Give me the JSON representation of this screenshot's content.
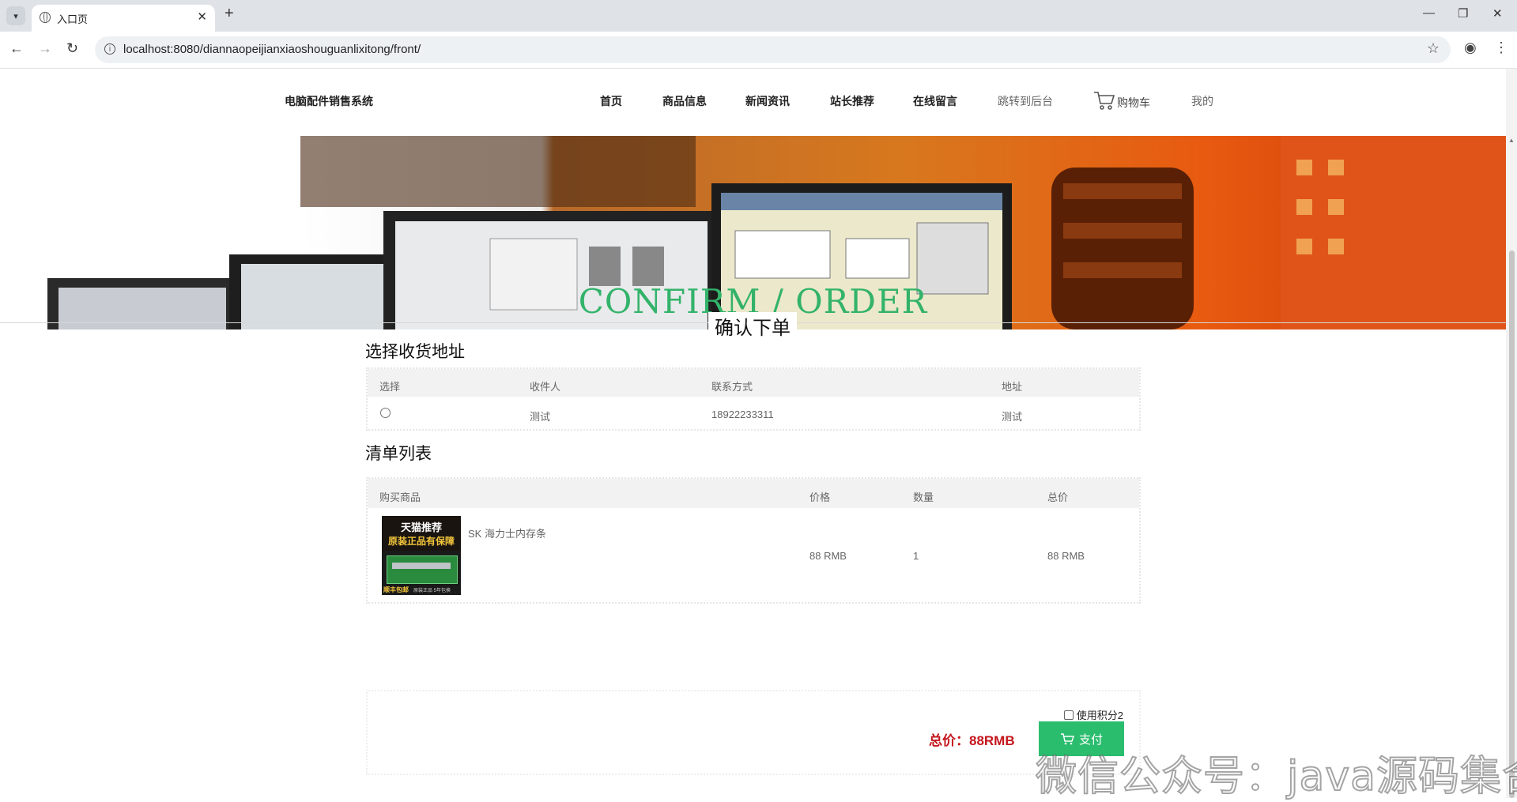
{
  "browser": {
    "tab_title": "入口页",
    "tab_close": "✕",
    "new_tab": "+",
    "url": "localhost:8080/diannaopeijianxiaoshouguanlixitong/front/",
    "window_controls": {
      "minimize": "—",
      "restore": "❐",
      "close": "✕"
    },
    "icons": [
      "tab-list-icon",
      "globe-icon",
      "back-icon",
      "forward-icon",
      "reload-icon",
      "site-info-icon",
      "bookmark-star-icon",
      "profile-icon",
      "menu-icon"
    ]
  },
  "site": {
    "brand": "电脑配件销售系统",
    "nav": [
      "首页",
      "商品信息",
      "新闻资讯",
      "站长推荐",
      "在线留言"
    ],
    "admin_link": "跳转到后台",
    "cart_label": "购物车",
    "mine_label": "我的",
    "accent_color": "#33b36a"
  },
  "page": {
    "heading_en": "CONFIRM / ORDER",
    "heading_cn": "确认下单"
  },
  "address_section": {
    "title": "选择收货地址",
    "columns": [
      "选择",
      "收件人",
      "联系方式",
      "地址"
    ],
    "rows": [
      {
        "selected": false,
        "recipient": "测试",
        "phone": "18922233311",
        "address": "测试"
      }
    ]
  },
  "order_section": {
    "title": "清单列表",
    "columns": [
      "购买商品",
      "价格",
      "数量",
      "总价"
    ],
    "items": [
      {
        "name": "SK 海力士内存条",
        "price": "88 RMB",
        "quantity": "1",
        "total": "88 RMB",
        "image_text": {
          "line1": "天猫推荐",
          "line2": "原装正品有保障",
          "footer": "顺丰包邮",
          "footer_sub": "原装正品 5年包换"
        }
      }
    ]
  },
  "payment": {
    "use_points_label": "使用积分2",
    "use_points_checked": false,
    "total_label": "总价：88RMB",
    "pay_button": "支付",
    "pay_color": "#2bbd6e"
  },
  "watermark": "微信公众号：java源码集合"
}
